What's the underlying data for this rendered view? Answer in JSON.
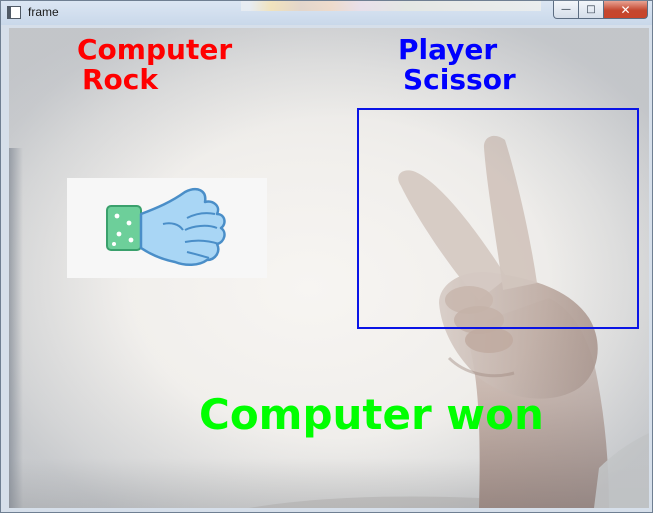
{
  "window": {
    "title": "frame",
    "buttons": {
      "minimize": "—",
      "maximize": "□",
      "close": "✕"
    }
  },
  "labels": {
    "computer_heading": "Computer",
    "computer_move": "Rock",
    "player_heading": "Player",
    "player_move": "Scissor",
    "result": "Computer won"
  },
  "colors": {
    "computer": "#ff0000",
    "player": "#0000ff",
    "result": "#00ff00",
    "player_box": "#0a14e6"
  },
  "icons": {
    "computer_choice": "rock-fist-icon"
  }
}
